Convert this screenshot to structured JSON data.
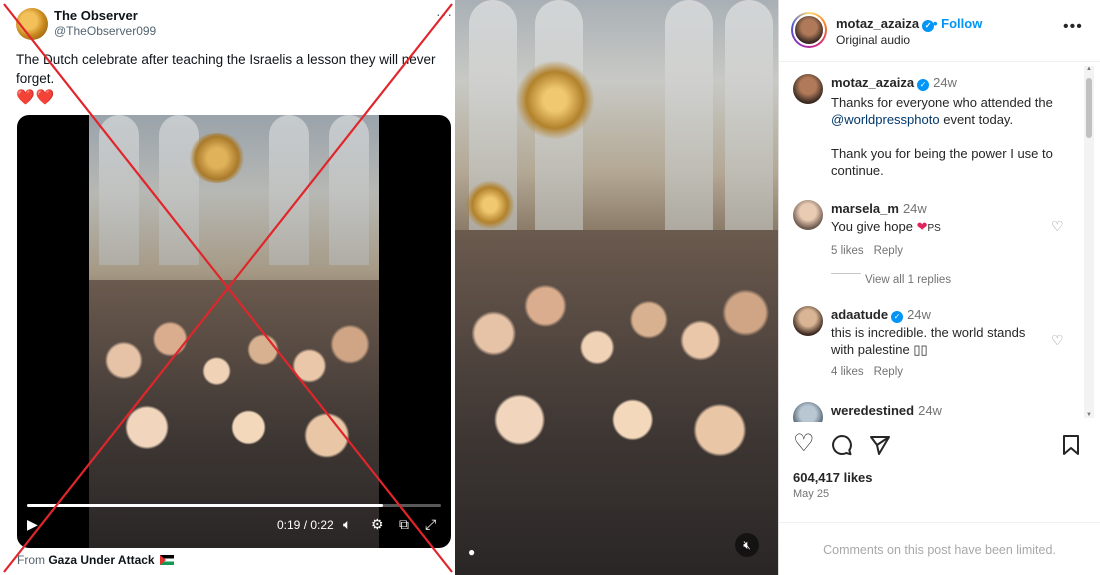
{
  "tweet": {
    "name": "The Observer",
    "handle": "@TheObserver099",
    "more": "···",
    "text": "The Dutch celebrate after teaching the Israelis a lesson they will never forget.",
    "hearts": "❤️❤️",
    "video": {
      "current_time": "0:19",
      "total_time": "0:22",
      "time_display": "0:19 / 0:22",
      "progress": 0.86
    },
    "from_prefix": "From",
    "from_source": "Gaza Under Attack"
  },
  "instagram": {
    "username": "motaz_azaiza",
    "follow_label": "• Follow",
    "audio_label": "Original audio",
    "more": "•••",
    "caption": {
      "username": "motaz_azaiza",
      "time": "24w",
      "text_before": "Thanks for everyone who attended the",
      "mention": "@worldpressphoto",
      "text_after": "event today.",
      "text_2": "Thank you for being the power I use to continue."
    },
    "comments": [
      {
        "username": "marsela_m",
        "time": "24w",
        "text": "You give hope",
        "suffix": "PS",
        "likes": "5 likes",
        "reply": "Reply",
        "view_replies": "View all 1 replies"
      },
      {
        "username": "adaatude",
        "time": "24w",
        "text": "this is incredible. the world stands with palestine ▯▯",
        "likes": "4 likes",
        "reply": "Reply"
      },
      {
        "username": "weredestined",
        "time": "24w"
      }
    ],
    "likes_count": "604,417 likes",
    "date": "May 25",
    "comments_limited": "Comments on this post have been limited."
  },
  "colors": {
    "x_mark": "#e0262b",
    "ig_blue": "#0095f6",
    "heart": "#e0245e"
  }
}
